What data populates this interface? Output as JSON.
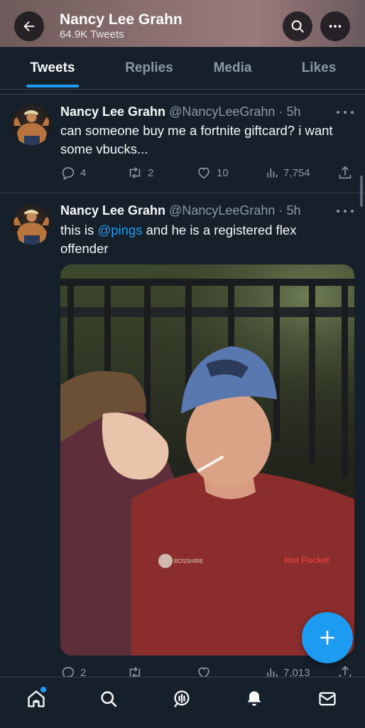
{
  "header": {
    "title": "Nancy Lee Grahn",
    "subtitle": "64.9K Tweets",
    "back_icon": "arrow-left-icon",
    "search_icon": "search-icon",
    "more_icon": "more-horizontal-icon"
  },
  "tabs": [
    {
      "label": "Tweets",
      "active": true
    },
    {
      "label": "Replies",
      "active": false
    },
    {
      "label": "Media",
      "active": false
    },
    {
      "label": "Likes",
      "active": false
    }
  ],
  "tweets": [
    {
      "name": "Nancy Lee Grahn",
      "handle": "@NancyLeeGrahn",
      "time": "5h",
      "text_lines": [
        "can someone buy me a fortnite giftcard? i want",
        "some vbucks..."
      ],
      "replies": "4",
      "retweets": "2",
      "likes": "10",
      "views": "7,754"
    },
    {
      "name": "Nancy Lee Grahn",
      "handle": "@NancyLeeGrahn",
      "time": "5h",
      "text_before": "this is ",
      "mention": "@pings",
      "text_after": " and he is a registered flex",
      "text_line2": "offender",
      "replies": "2",
      "retweets": "",
      "likes": "",
      "views": "7,013",
      "media": {
        "description_icon": "photo-icon",
        "cap_text": "",
        "shirt_logo": "Hot Pocket"
      }
    }
  ],
  "fab": {
    "icon": "plus-icon"
  },
  "bottom_nav": [
    {
      "icon": "home-icon",
      "has_dot": true
    },
    {
      "icon": "search-icon",
      "has_dot": false
    },
    {
      "icon": "spaces-icon",
      "has_dot": false
    },
    {
      "icon": "bell-icon",
      "has_dot": false
    },
    {
      "icon": "mail-icon",
      "has_dot": false
    }
  ],
  "colors": {
    "background": "#15202b",
    "accent": "#1d9bf0",
    "muted": "#8b98a5",
    "divider": "#38444d"
  }
}
